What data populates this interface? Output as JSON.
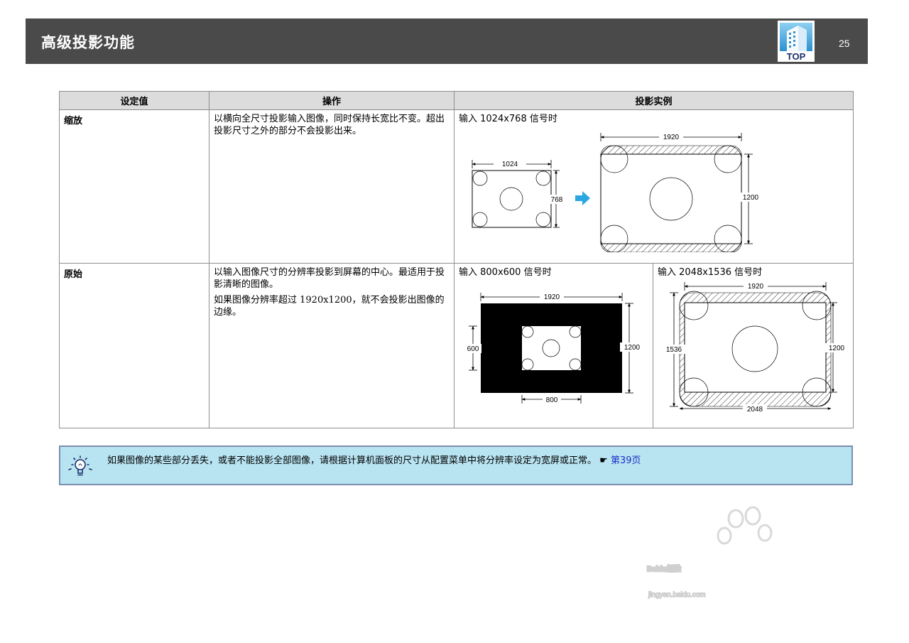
{
  "header": {
    "title": "高级投影功能",
    "page_number": "25",
    "top_label": "TOP"
  },
  "table": {
    "headers": [
      "设定值",
      "操作",
      "投影实例"
    ],
    "rows": [
      {
        "setting": "缩放",
        "desc": [
          "以横向全尺寸投影输入图像，同时保持长宽比不变。超出投影尺寸之外的部分不会投影出来。"
        ],
        "examples": [
          {
            "caption": "输入 1024x768 信号时",
            "labels": {
              "in_w": "1024",
              "in_h": "768",
              "out_w": "1920",
              "out_h": "1200"
            }
          }
        ]
      },
      {
        "setting": "原始",
        "desc": [
          "以输入图像尺寸的分辨率投影到屏幕的中心。最适用于投影清晰的图像。",
          "如果图像分辨率超过 1920x1200，就不会投影出图像的边缘。"
        ],
        "examples": [
          {
            "caption": "输入 800x600 信号时",
            "labels": {
              "top_w": "1920",
              "right_h": "1200",
              "left_h": "600",
              "bottom_w": "800"
            }
          },
          {
            "caption": "输入 2048x1536 信号时",
            "labels": {
              "top_w": "1920",
              "right_h": "1200",
              "left_h": "1536",
              "bottom_w": "2048"
            }
          }
        ]
      }
    ]
  },
  "tip": {
    "text": "如果图像的某些部分丢失，或者不能投影全部图像，请根据计算机面板的尺寸从配置菜单中将分辨率设定为宽屏或正常。",
    "pointer": "☛",
    "link": "第39页"
  },
  "watermark": {
    "brand": "Baidu经验",
    "url": "jingyan.baidu.com"
  },
  "colors": {
    "header_bg": "#4a4a4a",
    "table_header_bg": "#dcdcdc",
    "tip_bg": "#b8e3f1",
    "arrow": "#2aa7e0",
    "link": "#1a2fc4"
  }
}
